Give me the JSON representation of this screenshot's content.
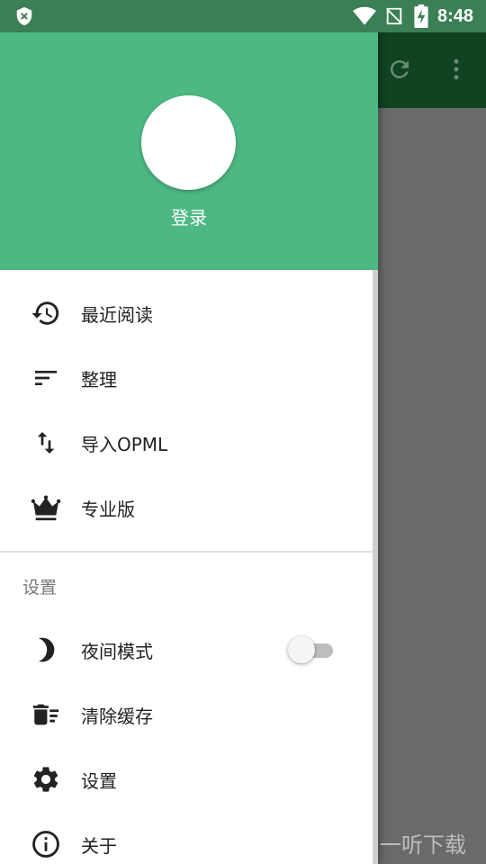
{
  "status_bar": {
    "time": "8:48",
    "icons": [
      "shield-icon",
      "wifi-icon",
      "no-signal-icon",
      "battery-charging-icon"
    ]
  },
  "background_app": {
    "toolbar_icons": [
      "refresh-icon",
      "more-vert-icon"
    ],
    "toolbar_color": "#0f4322"
  },
  "drawer": {
    "header_color": "#4db883",
    "login_label": "登录",
    "items": [
      {
        "icon": "history-icon",
        "label": "最近阅读"
      },
      {
        "icon": "sort-icon",
        "label": "整理"
      },
      {
        "icon": "import-export-icon",
        "label": "导入OPML"
      },
      {
        "icon": "crown-icon",
        "label": "专业版"
      }
    ],
    "settings_section": {
      "header": "设置",
      "items": [
        {
          "icon": "moon-icon",
          "label": "夜间模式",
          "toggle": false
        },
        {
          "icon": "delete-sweep-icon",
          "label": "清除缓存"
        },
        {
          "icon": "gear-icon",
          "label": "设置"
        },
        {
          "icon": "info-icon",
          "label": "关于"
        }
      ]
    }
  },
  "watermark": {
    "logo_char": "听",
    "text": "一听下载"
  }
}
